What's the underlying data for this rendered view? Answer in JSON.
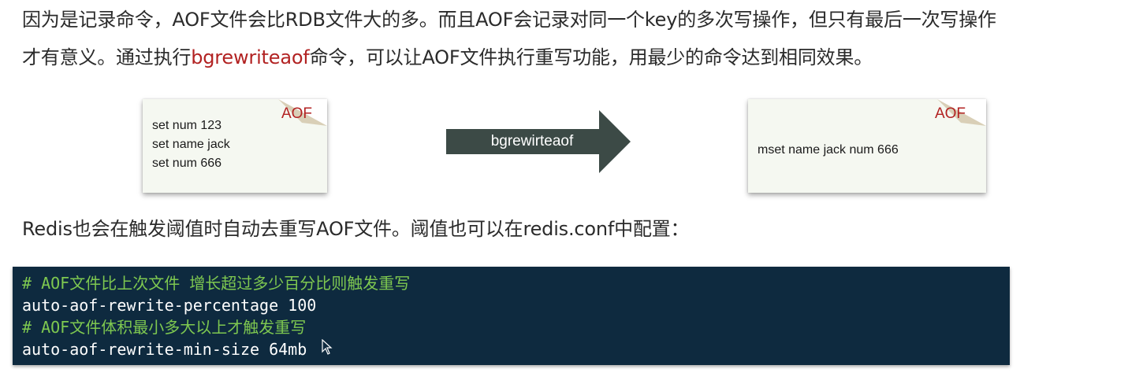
{
  "paragraph1": "因为是记录命令，AOF文件会比RDB文件大的多。而且AOF会记录对同一个key的多次写操作，但只有最后一次写操作",
  "paragraph2": {
    "before": "才有意义。通过执行",
    "highlight": "bgrewriteaof",
    "after": "命令，可以让AOF文件执行重写功能，用最少的命令达到相同效果。"
  },
  "left_card": {
    "tag": "AOF",
    "lines": [
      "set num 123",
      "set name jack",
      "set num 666"
    ]
  },
  "arrow": {
    "label": "bgrewirteaof"
  },
  "right_card": {
    "tag": "AOF",
    "line": "mset name jack num 666"
  },
  "paragraph3": "Redis也会在触发阈值时自动去重写AOF文件。阈值也可以在redis.conf中配置：",
  "code": {
    "lines": [
      {
        "text": "# AOF文件比上次文件 增长超过多少百分比则触发重写",
        "kind": "comment"
      },
      {
        "text": "auto-aof-rewrite-percentage 100",
        "kind": "text"
      },
      {
        "text": "# AOF文件体积最小多大以上才触发重写",
        "kind": "comment"
      },
      {
        "text": "auto-aof-rewrite-min-size 64mb",
        "kind": "text"
      }
    ]
  },
  "colors": {
    "highlight": "#b22222",
    "code_bg": "#0e2a3f",
    "comment": "#7ec850",
    "arrow": "#3c4a46",
    "card_bg": "#f5f8f1",
    "fold": "#d9cfb7"
  },
  "icons": {
    "cursor": "mouse-cursor-icon"
  }
}
